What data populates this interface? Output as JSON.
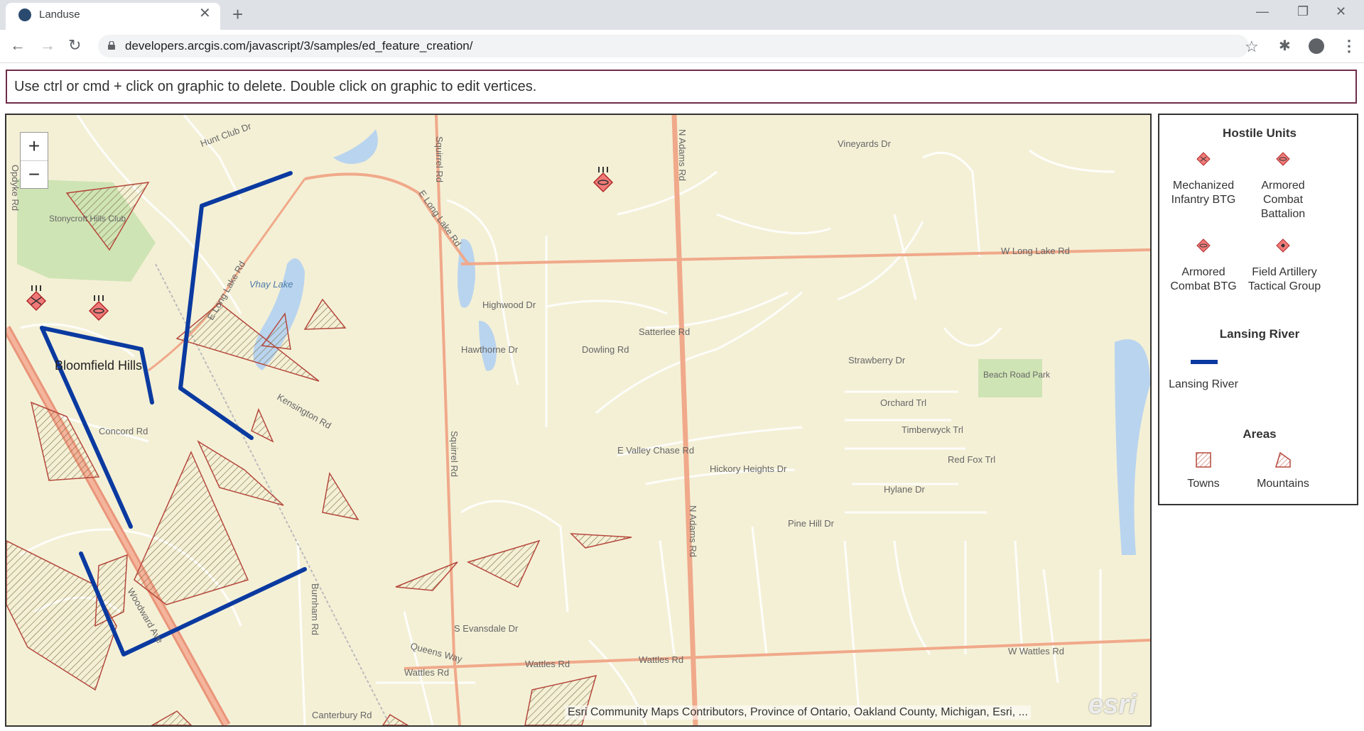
{
  "browser": {
    "tab_title": "Landuse",
    "url": "developers.arcgis.com/javascript/3/samples/ed_feature_creation/"
  },
  "instructions": "Use ctrl or cmd + click on graphic to delete. Double click on graphic to edit vertices.",
  "map": {
    "zoom_in": "+",
    "zoom_out": "−",
    "attribution": "Esri Community Maps Contributors, Province of Ontario, Oakland County, Michigan, Esri, ...",
    "logo_text": "esri",
    "labels": {
      "place": "Bloomfield Hills",
      "club": "Stonycroft Hills Club",
      "lake": "Vhay Lake",
      "park": "Beach Road Park",
      "squirrel_rd": "Squirrel Rd",
      "n_adams_rd": "N Adams Rd",
      "w_long_lake": "W Long Lake Rd",
      "e_long_lake": "E Long Lake Rd",
      "wattles": "Wattles Rd",
      "w_wattles": "W Wattles Rd",
      "woodward": "Woodward Ave",
      "opdyke": "Opdyke Rd",
      "highwood": "Highwood Dr",
      "hawthorne": "Hawthorne Dr",
      "dowling": "Dowling Rd",
      "satterlee": "Satterlee Rd",
      "strawberry": "Strawberry Dr",
      "orchard": "Orchard Trl",
      "timberwyck": "Timberwyck Trl",
      "redfox": "Red Fox Trl",
      "hylane": "Hylane Dr",
      "pinehill": "Pine Hill Dr",
      "hickory": "Hickory Heights Dr",
      "valleychase": "E Valley Chase Rd",
      "vineyards": "Vineyards Dr",
      "kensington": "Kensington Rd",
      "concord": "Concord Rd",
      "burnham": "Burnham Rd",
      "canterbury": "Canterbury Rd",
      "queens": "Queens Way",
      "evansdale": "S Evansdale Dr",
      "huntclub": "Hunt Club Dr"
    }
  },
  "legend": {
    "hostile_title": "Hostile Units",
    "hostile_items": [
      "Mechanized Infantry BTG",
      "Armored Combat Battalion",
      "Armored Combat BTG",
      "Field Artillery Tactical Group"
    ],
    "river_title": "Lansing River",
    "river_item": "Lansing River",
    "areas_title": "Areas",
    "area_items": [
      "Towns",
      "Mountains"
    ]
  },
  "colors": {
    "river": "#0a3aa0",
    "area_stroke": "#b5483c",
    "hostile_fill": "#f07a78",
    "map_bg": "#f4f0d6",
    "road": "#f0a98a"
  }
}
